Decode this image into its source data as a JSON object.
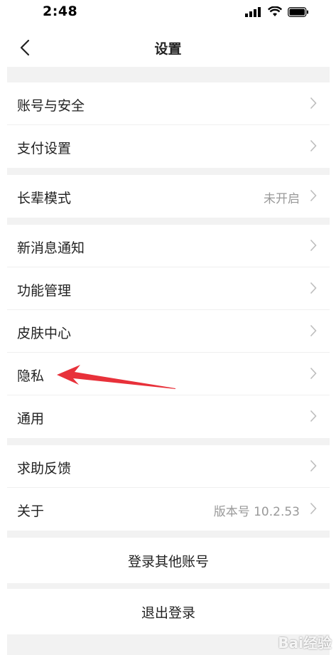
{
  "status": {
    "time": "2:48"
  },
  "nav": {
    "title": "设置"
  },
  "groups": [
    {
      "items": [
        {
          "label": "账号与安全"
        },
        {
          "label": "支付设置"
        }
      ]
    },
    {
      "items": [
        {
          "label": "长辈模式",
          "value": "未开启"
        }
      ]
    },
    {
      "items": [
        {
          "label": "新消息通知"
        },
        {
          "label": "功能管理"
        },
        {
          "label": "皮肤中心"
        },
        {
          "label": "隐私"
        },
        {
          "label": "通用"
        }
      ]
    },
    {
      "items": [
        {
          "label": "求助反馈"
        },
        {
          "label": "关于",
          "value": "版本号 10.2.53"
        }
      ]
    }
  ],
  "actions": {
    "switch_account": "登录其他账号",
    "logout": "退出登录"
  },
  "annotation": {
    "arrow_color": "#e8313a"
  },
  "watermark": "Bai经验"
}
